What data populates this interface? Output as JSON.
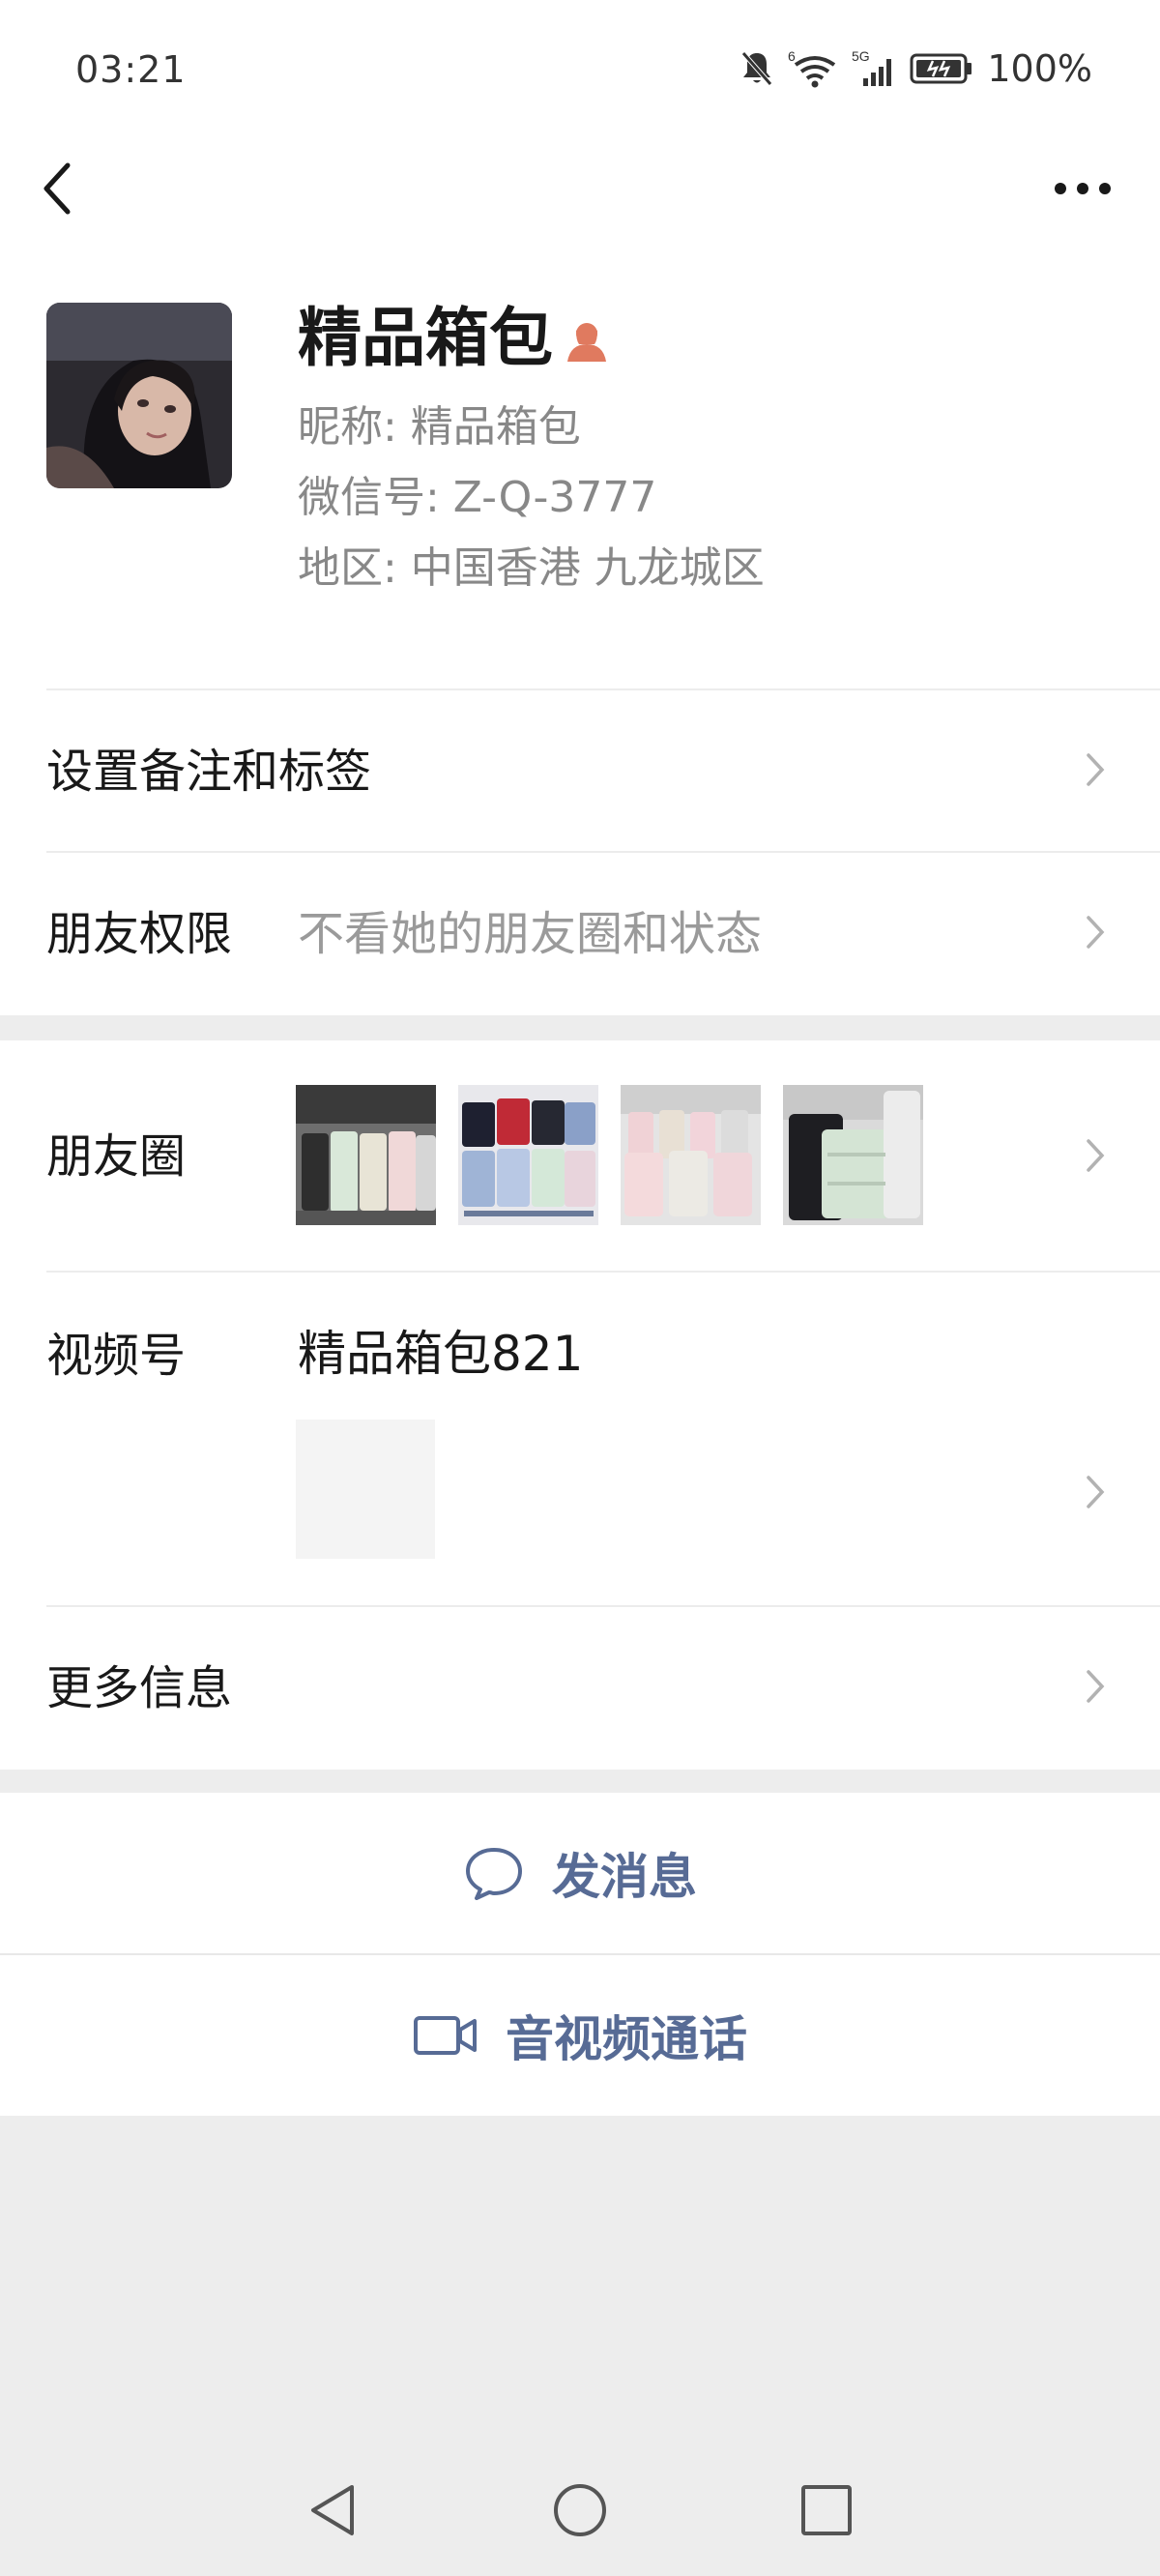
{
  "status_bar": {
    "time": "03:21",
    "signal_label_1": "6",
    "signal_label_2": "5G",
    "battery": "100%"
  },
  "profile": {
    "name": "精品箱包",
    "nickname": "昵称: 精品箱包",
    "wechat_id": "微信号: Z-Q-3777",
    "region": "地区: 中国香港 九龙城区",
    "gender_icon": "female-icon",
    "gender_color": "#e07a5f"
  },
  "rows": {
    "remark_label": "设置备注和标签",
    "permission_label": "朋友权限",
    "permission_value": "不看她的朋友圈和状态",
    "moments_label": "朋友圈",
    "channels_label": "视频号",
    "channels_name": "精品箱包821",
    "more_label": "更多信息"
  },
  "actions": {
    "message_label": "发消息",
    "call_label": "音视频通话"
  },
  "colors": {
    "link": "#576b95",
    "background": "#ededed"
  }
}
